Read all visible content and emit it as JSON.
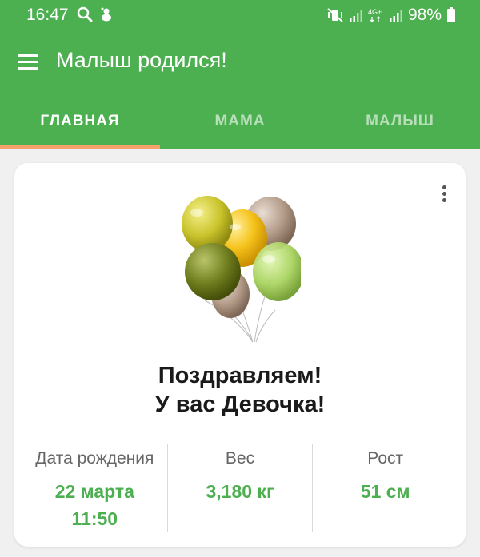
{
  "status_bar": {
    "time": "16:47",
    "battery": "98%",
    "left_icons": [
      "search-icon",
      "notification-icon"
    ],
    "right_icons": [
      "mute-vibrate-icon",
      "signal-icon",
      "4g-icon",
      "signal-icon",
      "battery-icon"
    ]
  },
  "toolbar": {
    "title": "Малыш родился!",
    "menu_icon": "hamburger-menu-icon"
  },
  "tabs": [
    {
      "label": "ГЛАВНАЯ",
      "active": true
    },
    {
      "label": "МАМА",
      "active": false
    },
    {
      "label": "МАЛЫШ",
      "active": false
    }
  ],
  "card": {
    "image": "balloons-image",
    "congrats_line1": "Поздравляем!",
    "congrats_line2": "У вас Девочка!",
    "stats": [
      {
        "label": "Дата рождения",
        "value_line1": "22 марта",
        "value_line2": "11:50"
      },
      {
        "label": "Вес",
        "value_line1": "3,180 кг",
        "value_line2": ""
      },
      {
        "label": "Рост",
        "value_line1": "51 см",
        "value_line2": ""
      }
    ]
  },
  "colors": {
    "primary": "#4caf50",
    "tab_indicator": "#f5a26b",
    "background": "#f0f0f0"
  }
}
